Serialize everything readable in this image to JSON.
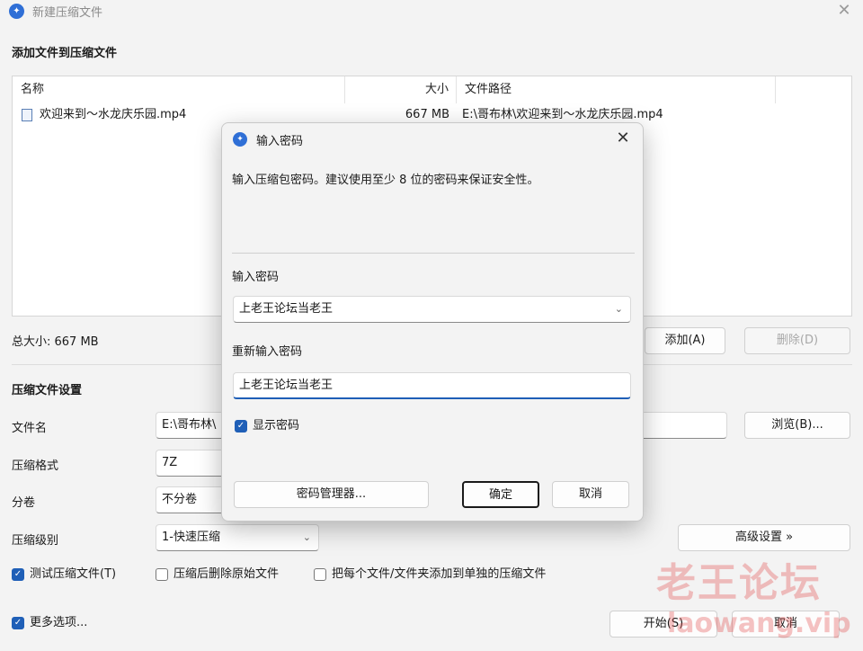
{
  "window": {
    "title": "新建压缩文件"
  },
  "files_section": {
    "heading": "添加文件到压缩文件",
    "columns": {
      "name": "名称",
      "size": "大小",
      "path": "文件路径"
    },
    "rows": [
      {
        "name": "欢迎来到～水龙庆乐园.mp4",
        "size": "667 MB",
        "path": "E:\\哥布林\\欢迎来到～水龙庆乐园.mp4"
      }
    ],
    "total_size": "总大小: 667 MB",
    "add_button": "添加(A)",
    "delete_button": "删除(D)"
  },
  "settings": {
    "heading": "压缩文件设置",
    "filename_label": "文件名",
    "filename_value": "E:\\哥布林\\",
    "browse_button": "浏览(B)...",
    "format_label": "压缩格式",
    "format_value": "7Z",
    "split_label": "分卷",
    "split_value": "不分卷",
    "level_label": "压缩级别",
    "level_value": "1-快速压缩",
    "advanced_button": "高级设置 »",
    "test_checkbox": "测试压缩文件(T)",
    "delete_after_checkbox": "压缩后删除原始文件",
    "separate_checkbox": "把每个文件/文件夹添加到单独的压缩文件",
    "more_options": "更多选项...",
    "start_button": "开始(S)",
    "cancel_button": "取消"
  },
  "dialog": {
    "title": "输入密码",
    "description": "输入压缩包密码。建议使用至少 8 位的密码来保证安全性。",
    "password_label": "输入密码",
    "password_value": "上老王论坛当老王",
    "confirm_label": "重新输入密码",
    "confirm_value": "上老王论坛当老王",
    "show_password": "显示密码",
    "manager_button": "密码管理器...",
    "ok_button": "确定",
    "cancel_button": "取消"
  },
  "watermark": {
    "text": "老王论坛",
    "sub": "laowang.vip"
  },
  "colors": {
    "accent": "#1f5fb7",
    "watermark": "#e15050"
  }
}
